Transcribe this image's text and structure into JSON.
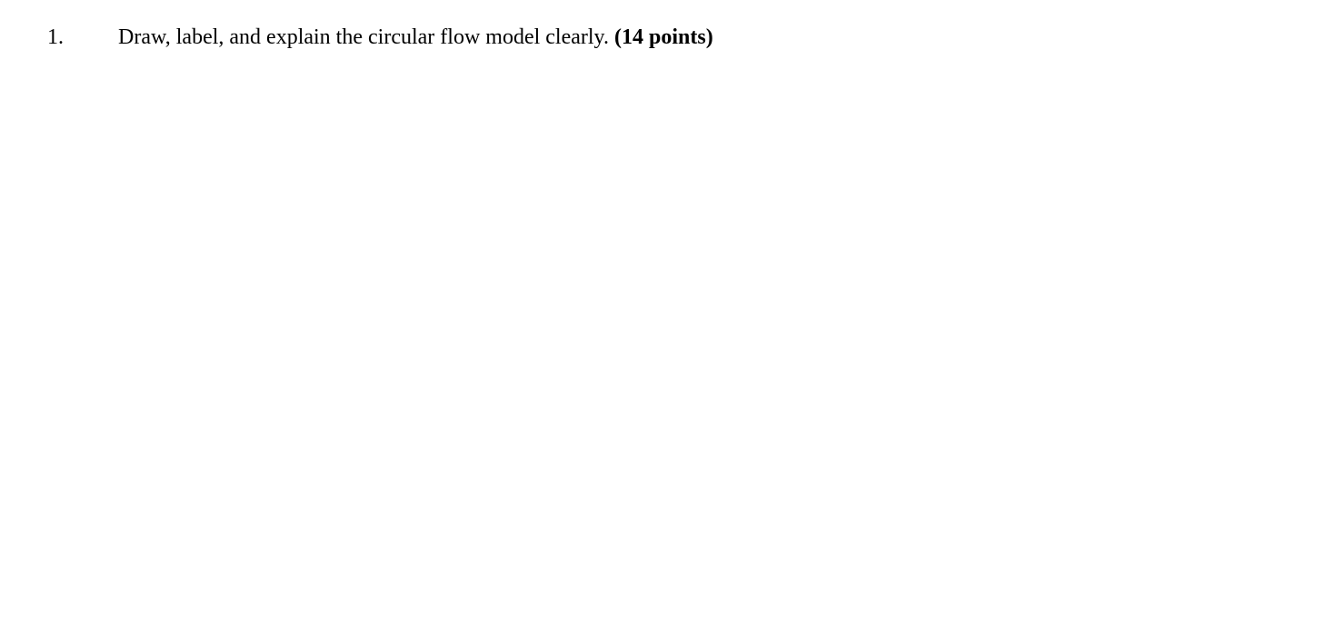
{
  "question": {
    "number": "1.",
    "text": "Draw, label, and explain the circular flow model clearly.  ",
    "points": "(14 points)"
  }
}
